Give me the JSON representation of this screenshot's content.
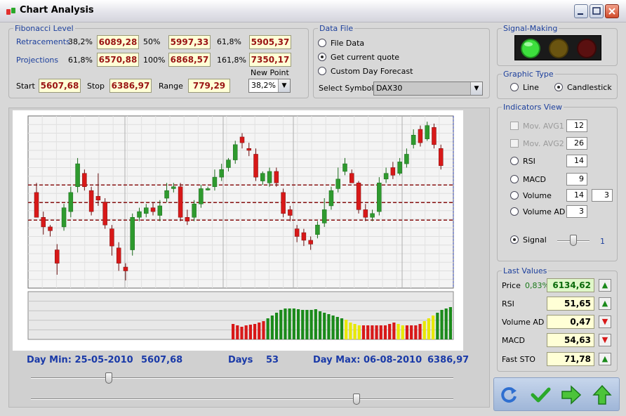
{
  "window": {
    "title": "Chart Analysis"
  },
  "fibonacci": {
    "legend": "Fibonacci Level",
    "retracements_label": "Retracements",
    "retracements": [
      {
        "pct": "38,2%",
        "value": "6089,28"
      },
      {
        "pct": "50%",
        "value": "5997,33"
      },
      {
        "pct": "61,8%",
        "value": "5905,37"
      }
    ],
    "projections_label": "Projections",
    "projections": [
      {
        "pct": "61,8%",
        "value": "6570,88"
      },
      {
        "pct": "100%",
        "value": "6868,57"
      },
      {
        "pct": "161,8%",
        "value": "7350,17"
      }
    ],
    "start_label": "Start",
    "start_value": "5607,68",
    "stop_label": "Stop",
    "stop_value": "6386,97",
    "range_label": "Range",
    "range_value": "779,29",
    "new_point_label": "New Point",
    "new_point_value": "38,2%"
  },
  "data_file": {
    "legend": "Data File",
    "options": [
      "File Data",
      "Get current quote",
      "Custom Day Forecast"
    ],
    "selected": "Get current quote",
    "symbol_label": "Select Symbol",
    "symbol_value": "DAX30"
  },
  "signal_making": {
    "legend": "Signal-Making",
    "lights": [
      "green",
      "yellow",
      "red"
    ],
    "active": "green"
  },
  "graphic_type": {
    "legend": "Graphic Type",
    "options": [
      "Line",
      "Candlestick"
    ],
    "selected": "Candlestick"
  },
  "indicators": {
    "legend": "Indicators View",
    "mov_avg1": {
      "label": "Mov. AVG1",
      "value": "12",
      "enabled": false
    },
    "mov_avg2": {
      "label": "Mov. AVG2",
      "value": "26",
      "enabled": false
    },
    "rsi": {
      "label": "RSI",
      "value": "14"
    },
    "macd": {
      "label": "MACD",
      "value": "9"
    },
    "volume": {
      "label": "Volume",
      "value": "14",
      "value2": "3"
    },
    "volume_ad": {
      "label": "Volume AD",
      "value": "3"
    },
    "signal": {
      "label": "Signal",
      "value": "1",
      "selected": true
    }
  },
  "last_values": {
    "legend": "Last Values",
    "price": {
      "label": "Price",
      "change": "0,83%",
      "value": "6134,62",
      "trend": "up"
    },
    "rsi": {
      "label": "RSI",
      "value": "51,65",
      "trend": "up"
    },
    "volume_ad": {
      "label": "Volume AD",
      "value": "0,47",
      "trend": "down"
    },
    "macd": {
      "label": "MACD",
      "value": "54,63",
      "trend": "down"
    },
    "fast_sto": {
      "label": "Fast STO",
      "value": "71,78",
      "trend": "up"
    }
  },
  "chart_footer": {
    "day_min_label": "Day Min: 25-05-2010",
    "day_min_value": "5607,68",
    "days_label": "Days",
    "days_value": "53",
    "day_max_label": "Day Max: 06-08-2010",
    "day_max_value": "6386,97"
  },
  "chart_data": {
    "type": "candlestick",
    "ylim": [
      5550,
      6450
    ],
    "fib_lines": [
      6089.28,
      5997.33,
      5905.37
    ],
    "candles": [
      [
        6050,
        5920,
        5960,
        6100
      ],
      [
        5920,
        5870,
        5830,
        5950
      ],
      [
        5870,
        5850,
        5820,
        5880
      ],
      [
        5750,
        5680,
        5620,
        5780
      ],
      [
        5870,
        5970,
        5850,
        5990
      ],
      [
        5950,
        6050,
        5920,
        6080
      ],
      [
        6080,
        6200,
        6050,
        6230
      ],
      [
        6150,
        6080,
        6060,
        6170
      ],
      [
        6060,
        5950,
        5930,
        6080
      ],
      [
        6030,
        6010,
        5980,
        6150
      ],
      [
        6000,
        5880,
        5860,
        6020
      ],
      [
        5860,
        5770,
        5720,
        5880
      ],
      [
        5760,
        5680,
        5640,
        5790
      ],
      [
        5660,
        5640,
        5590,
        5680
      ],
      [
        5750,
        5920,
        5720,
        5940
      ],
      [
        5920,
        5950,
        5900,
        5970
      ],
      [
        5940,
        5970,
        5920,
        5990
      ],
      [
        5970,
        5950,
        5930,
        6000
      ],
      [
        5930,
        5980,
        5900,
        6010
      ],
      [
        6020,
        6060,
        6000,
        6100
      ],
      [
        6070,
        6080,
        6050,
        6100
      ],
      [
        6080,
        5920,
        5900,
        6100
      ],
      [
        5920,
        5900,
        5880,
        5960
      ],
      [
        5920,
        5990,
        5900,
        6010
      ],
      [
        5990,
        6070,
        5970,
        6090
      ],
      [
        6070,
        6070,
        6060,
        6080
      ],
      [
        6080,
        6130,
        6060,
        6170
      ],
      [
        6130,
        6170,
        6110,
        6200
      ],
      [
        6180,
        6220,
        6160,
        6230
      ],
      [
        6220,
        6300,
        6200,
        6320
      ],
      [
        6340,
        6310,
        6280,
        6360
      ],
      [
        6280,
        6270,
        6240,
        6310
      ],
      [
        6250,
        6130,
        6110,
        6280
      ],
      [
        6110,
        6150,
        6090,
        6160
      ],
      [
        6100,
        6160,
        6080,
        6180
      ],
      [
        6160,
        6100,
        6080,
        6180
      ],
      [
        6050,
        5940,
        5920,
        6070
      ],
      [
        5960,
        5930,
        5900,
        5980
      ],
      [
        5860,
        5820,
        5790,
        5880
      ],
      [
        5840,
        5800,
        5770,
        5860
      ],
      [
        5800,
        5780,
        5750,
        5820
      ],
      [
        5830,
        5880,
        5810,
        5900
      ],
      [
        5890,
        5960,
        5870,
        6020
      ],
      [
        5980,
        6060,
        5960,
        6080
      ],
      [
        6070,
        6120,
        6050,
        6180
      ],
      [
        6160,
        6200,
        6140,
        6230
      ],
      [
        6150,
        6100,
        6120,
        6170
      ],
      [
        6100,
        5960,
        5940,
        6110
      ],
      [
        5960,
        5920,
        5900,
        5990
      ],
      [
        5920,
        5940,
        5900,
        5960
      ],
      [
        5950,
        6100,
        5930,
        6130
      ],
      [
        6120,
        6150,
        6100,
        6180
      ],
      [
        6180,
        6140,
        6120,
        6210
      ],
      [
        6150,
        6210,
        6140,
        6230
      ],
      [
        6200,
        6250,
        6180,
        6280
      ],
      [
        6300,
        6350,
        6280,
        6380
      ],
      [
        6380,
        6310,
        6290,
        6400
      ],
      [
        6330,
        6400,
        6320,
        6420
      ],
      [
        6390,
        6300,
        6280,
        6410
      ],
      [
        6280,
        6190,
        6170,
        6300
      ]
    ],
    "indicator_bars": []
  }
}
